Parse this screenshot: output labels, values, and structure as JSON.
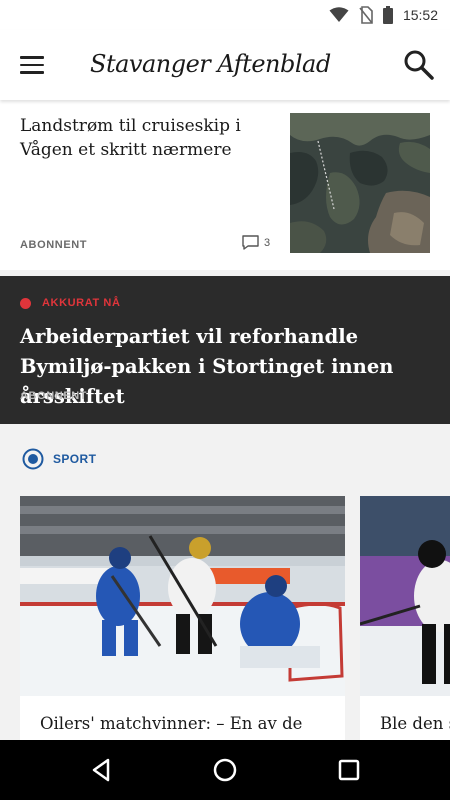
{
  "status_bar": {
    "time": "15:52",
    "icons": [
      "wifi-icon",
      "no-sim-icon",
      "battery-icon"
    ]
  },
  "header": {
    "logo": "Stavanger Aftenblad",
    "menu_icon": "hamburger-menu-icon",
    "search_icon": "search-icon"
  },
  "articles": [
    {
      "title": "Landstrøm til cruiseskip i Vågen et skritt nærmere",
      "label": "ABONNENT",
      "comments": "3",
      "image": "aerial-map-image"
    }
  ],
  "breaking": {
    "tag": "AKKURAT NÅ",
    "title": "Arbeiderpartiet vil reforhandle Bymiljø-pakken i Stortinget innen årsskiftet",
    "label": "ABONNENT",
    "accent_color": "#e0353b"
  },
  "sport": {
    "label": "SPORT",
    "accent_color": "#1f5aa0",
    "cards": [
      {
        "title": "Oilers' matchvinner: – En av de",
        "image": "ice-hockey-photo"
      },
      {
        "title": "Ble den s",
        "image": "ice-hockey-photo"
      }
    ]
  },
  "nav": {
    "back_icon": "back-icon",
    "home_icon": "home-icon",
    "recents_icon": "recents-icon"
  }
}
